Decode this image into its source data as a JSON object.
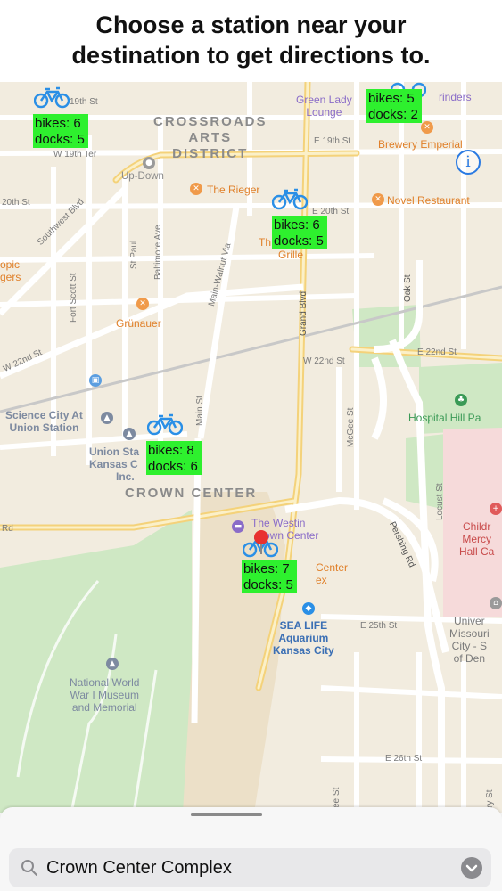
{
  "header": {
    "line1": "Choose a station near your",
    "line2": "destination to get directions to."
  },
  "map": {
    "district_labels": {
      "crossroads_1": "CROSSROADS",
      "crossroads_2": "ARTS",
      "crossroads_3": "DISTRICT",
      "crown_center": "CROWN CENTER"
    },
    "streets": {
      "w19th": "19th St",
      "w19th_ter": "W 19th Ter",
      "e19th": "E 19th St",
      "w20th": "20th St",
      "e20th": "E 20th St",
      "southwest": "Southwest Blvd",
      "st_paul": "St Paul",
      "baltimore": "Baltimore Ave",
      "main_walnut": "Main-Walnut Via",
      "fort_scott": "Fort Scott St",
      "grand": "Grand Blvd",
      "oak": "Oak St",
      "w22nd_left": "W 22nd St",
      "w22nd_mid": "W 22nd St",
      "e22nd": "E 22nd St",
      "main_st": "Main St",
      "mcgee": "McGee St",
      "locust": "Locust St",
      "pershing": "Pershing Rd",
      "e25th": "E 25th St",
      "e26th": "E 26th St",
      "rd_left": "Rd",
      "ee_st": "ee St",
      "ry_st": "ry St"
    },
    "places": {
      "up_down": "Up-Down",
      "the_rieger": "The Rieger",
      "novel": "Novel Restaurant",
      "brewery": "Brewery Emperial",
      "green_lady_1": "Green Lady",
      "green_lady_2": "Lounge",
      "grinders": "rinders",
      "grunauer": "Grünauer",
      "tropic_1": "opic",
      "tropic_2": "gers",
      "grille_pre": "Th",
      "grille": "Grille",
      "science_city_1": "Science City At",
      "science_city_2": "Union Station",
      "union_sta_1": "Union Sta",
      "union_sta_2": "Kansas C",
      "union_sta_3": "Inc.",
      "westin_1": "The Westin",
      "westin_2": "own Center",
      "center_ex_1": "Center",
      "center_ex_2": "ex",
      "sealife_1": "SEA LIFE",
      "sealife_2": "Aquarium",
      "sealife_3": "Kansas City",
      "wwi_1": "National World",
      "wwi_2": "War I Museum",
      "wwi_3": "and Memorial",
      "hospital_hill": "Hospital Hill Pa",
      "childrens_1": "Childr",
      "childrens_2": "Mercy",
      "childrens_3": "Hall Ca",
      "univ_1": "Univer",
      "univ_2": "Missouri",
      "univ_3": "City - S",
      "univ_4": "of Den"
    },
    "info_button": "i"
  },
  "stations": [
    {
      "bikes": "bikes: 6",
      "docks": "docks: 5"
    },
    {
      "bikes": "bikes: 5",
      "docks": "docks: 2"
    },
    {
      "bikes": "bikes: 6",
      "docks": "docks: 5"
    },
    {
      "bikes": "bikes: 8",
      "docks": "docks: 6"
    },
    {
      "bikes": "bikes: 7",
      "docks": "docks: 5"
    }
  ],
  "search": {
    "value": "Crown Center Complex"
  },
  "colors": {
    "station_label_bg": "#2ef02e",
    "bike_icon": "#2a8fe6",
    "selected_pin": "#e8312f",
    "map_background": "#f2ecdf",
    "park_green": "#cfe8c4",
    "hospital_pink": "#f6dada"
  },
  "icons": {
    "station": "bicycle-icon",
    "pin": "location-pin-icon",
    "search": "magnifying-glass-icon",
    "dropdown": "chevron-down-icon",
    "info": "info-circle-icon"
  }
}
